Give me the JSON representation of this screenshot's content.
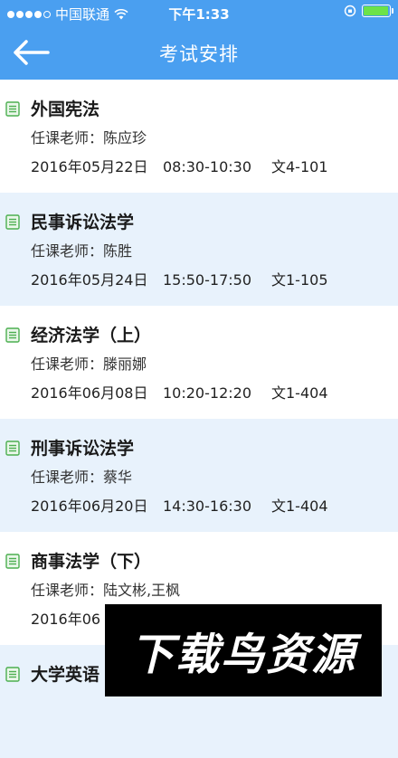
{
  "status_bar": {
    "carrier": "中国联通",
    "time": "下午1:33"
  },
  "colors": {
    "header_bg": "#4a9ff0",
    "row_alt_bg": "#e8f2fc",
    "icon_green": "#4caf50",
    "battery_green": "#6ce24a"
  },
  "header": {
    "title": "考试安排",
    "back_icon": "arrow-left-icon"
  },
  "exams": [
    {
      "course": "外国宪法",
      "teacher": "任课老师：陈应珍",
      "date": "2016年05月22日",
      "time": "08:30-10:30",
      "room": "文4-101"
    },
    {
      "course": "民事诉讼法学",
      "teacher": "任课老师：陈胜",
      "date": "2016年05月24日",
      "time": "15:50-17:50",
      "room": "文1-105"
    },
    {
      "course": "经济法学（上）",
      "teacher": "任课老师：滕丽娜",
      "date": "2016年06月08日",
      "time": "10:20-12:20",
      "room": "文1-404"
    },
    {
      "course": "刑事诉讼法学",
      "teacher": "任课老师：蔡华",
      "date": "2016年06月20日",
      "time": "14:30-16:30",
      "room": "文1-404"
    },
    {
      "course": "商事法学（下）",
      "teacher": "任课老师：陆文彬,王枫",
      "date": "2016年06",
      "time": "",
      "room": ""
    },
    {
      "course": "大学英语",
      "teacher": "",
      "date": "",
      "time": "",
      "room": ""
    }
  ],
  "watermark": {
    "text": "下载鸟资源"
  }
}
